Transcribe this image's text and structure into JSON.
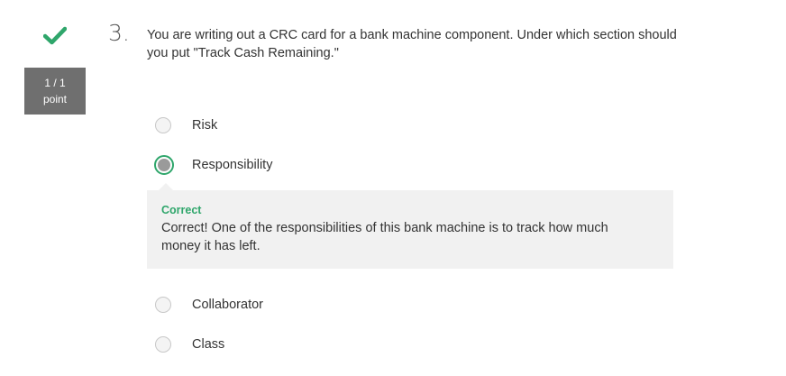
{
  "status": {
    "icon": "checkmark-icon",
    "color": "#2fa66b",
    "score_line1": "1 / 1",
    "score_line2": "point"
  },
  "question": {
    "number": "3.",
    "text": "You are writing out a CRC card for a bank machine component. Under which section should you put \"Track Cash Remaining.\""
  },
  "options": [
    {
      "label": "Risk",
      "selected": false
    },
    {
      "label": "Responsibility",
      "selected": true
    },
    {
      "label": "Collaborator",
      "selected": false
    },
    {
      "label": "Class",
      "selected": false
    }
  ],
  "feedback": {
    "title": "Correct",
    "text": "Correct! One of the responsibilities of this bank machine is to track how much money it has left.",
    "title_color": "#2fa66b"
  }
}
